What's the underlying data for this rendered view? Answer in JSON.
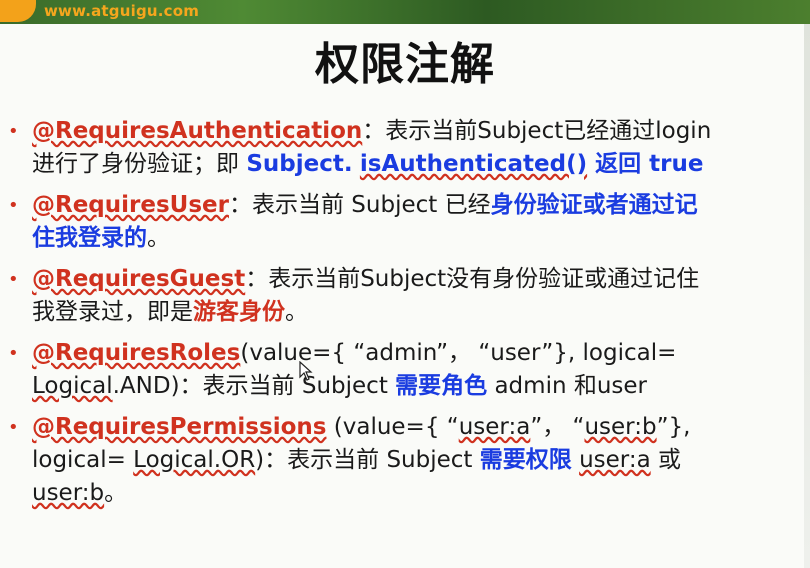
{
  "header": {
    "site_url": "www.atguigu.com"
  },
  "title": "权限注解",
  "items": [
    {
      "annotation": "@RequiresAuthentication",
      "desc1": "：表示当前Subject已经通过login",
      "desc2": "进行了身份验证；即 ",
      "em1": "Subject.",
      "em2": "isAuthenticated()",
      "em3": " 返回 true"
    },
    {
      "annotation": "@RequiresUser",
      "desc1": "：表示当前 Subject 已经",
      "em1": "身份验证或者通过记",
      "em2": "住我登录的",
      "desc2": "。"
    },
    {
      "annotation": "@RequiresGuest",
      "desc1": "：表示当前Subject没有身份验证或通过记住",
      "desc2": "我登录过，即是",
      "em1": "游客身份",
      "desc3": "。"
    },
    {
      "annotation": "@RequiresRoles",
      "desc1": "(value={ “admin”， “user”}, logical=",
      "logical": "Logical",
      "desc2": ".AND)：表示当前 Subject ",
      "em1": "需要角色",
      "desc3": " admin 和user"
    },
    {
      "annotation": "@RequiresPermissions",
      "desc1": " (value={ “",
      "v1": "user:a",
      "desc1b": "”， “",
      "v2": "user:b",
      "desc1c": "”},",
      "desc2": "logical= ",
      "logical": "Logical.OR",
      "desc3": ")：表示当前 Subject ",
      "em1": "需要权限",
      "desc4": " ",
      "v3": "user:a",
      "desc5": " 或",
      "v4": "user:b",
      "desc6": "。"
    }
  ],
  "colors": {
    "accent_red": "#d0321f",
    "accent_blue": "#1a3ce0",
    "header_green": "#3a6b2a",
    "logo_orange": "#f3a21a"
  },
  "icons": {
    "cursor": "mouse-pointer-icon"
  }
}
